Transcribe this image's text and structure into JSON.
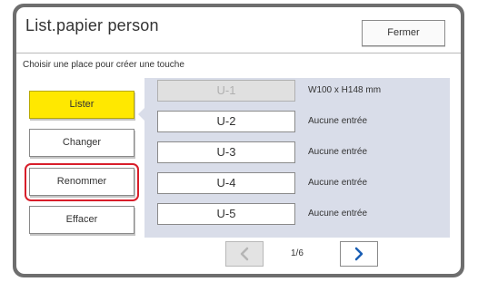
{
  "window": {
    "title": "List.papier person",
    "close_label": "Fermer"
  },
  "instruction": "Choisir une place pour créer une touche",
  "actions": [
    {
      "label": "Lister",
      "active": true
    },
    {
      "label": "Changer",
      "active": false
    },
    {
      "label": "Renommer",
      "active": false,
      "highlighted": true
    },
    {
      "label": "Effacer",
      "active": false
    }
  ],
  "entries": [
    {
      "name": "U-1",
      "info": "W100 x H148 mm",
      "disabled": true
    },
    {
      "name": "U-2",
      "info": "Aucune entrée",
      "disabled": false
    },
    {
      "name": "U-3",
      "info": "Aucune entrée",
      "disabled": false
    },
    {
      "name": "U-4",
      "info": "Aucune entrée",
      "disabled": false
    },
    {
      "name": "U-5",
      "info": "Aucune entrée",
      "disabled": false
    }
  ],
  "pagination": {
    "page_text": "1/6",
    "prev_enabled": false,
    "next_enabled": true,
    "prev_icon": "chevron-left-icon",
    "next_icon": "chevron-right-icon"
  },
  "colors": {
    "active_button": "#ffe800",
    "highlight_border": "#d81e2a",
    "list_background": "#d9dde9",
    "next_arrow": "#1a5fb4",
    "prev_arrow_disabled": "#b5b5b5"
  }
}
